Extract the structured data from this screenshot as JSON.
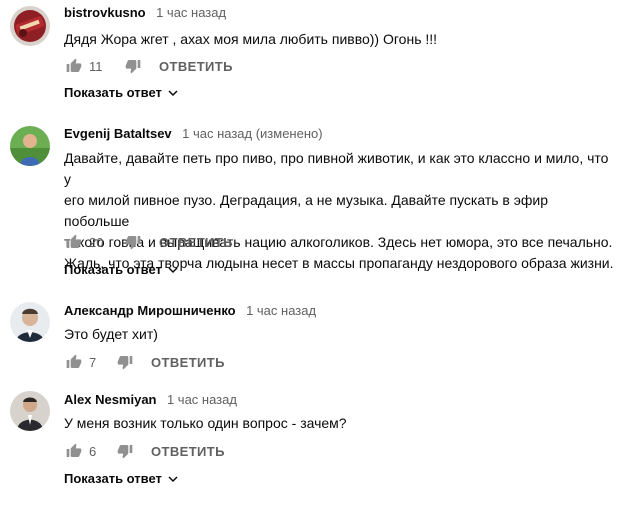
{
  "comments": [
    {
      "author": "bistrovkusno",
      "time": "1 час назад",
      "text": "Дядя Жора жгет , ахах моя мила любить пивво)) Огонь !!!",
      "likes": "11",
      "reply_label": "ОТВЕТИТЬ",
      "show_replies_label": "Показать ответ"
    },
    {
      "author": "Evgenij Bataltsev",
      "time": "1 час назад (изменено)",
      "text": "Давайте, давайте петь про пиво, про пивной животик, и как это классно и мило, что у\nего милой пивное пузо. Деградация, а не музыка. Давайте пускать в эфир побольше\nтакого говна и выращивать нацию алкоголиков. Здесь нет юмора, это все печально.\nЖаль, что эта творча людына несет в массы пропаганду нездорового образа жизни.",
      "likes": "20",
      "reply_label": "ОТВЕТИТЬ",
      "show_replies_label": "Показать ответ"
    },
    {
      "author": "Александр Мирошниченко",
      "time": "1 час назад",
      "text": "Это будет хит)",
      "likes": "7",
      "reply_label": "ОТВЕТИТЬ"
    },
    {
      "author": "Alex Nesmiyan",
      "time": "1 час назад",
      "text": "У меня возник только один вопрос - зачем?",
      "likes": "6",
      "reply_label": "ОТВЕТИТЬ",
      "show_replies_label": "Показать ответ"
    }
  ],
  "icons": {
    "like": "thumb-up-icon",
    "dislike": "thumb-down-icon",
    "expand": "chevron-down-icon"
  },
  "colors": {
    "text_primary": "#0a0a0a",
    "text_secondary": "#606060",
    "icon": "#909090"
  }
}
